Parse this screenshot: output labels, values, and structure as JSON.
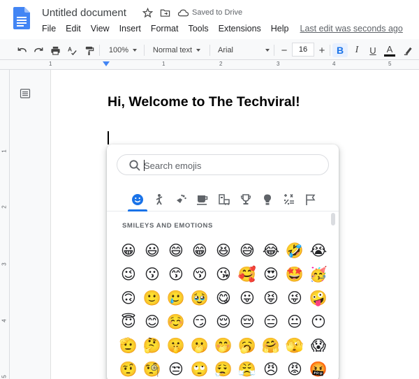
{
  "header": {
    "doc_title": "Untitled document",
    "saved_status": "Saved to Drive",
    "last_edit": "Last edit was seconds ago",
    "menu": [
      "File",
      "Edit",
      "View",
      "Insert",
      "Format",
      "Tools",
      "Extensions",
      "Help"
    ]
  },
  "toolbar": {
    "zoom": "100%",
    "style": "Normal text",
    "font": "Arial",
    "font_size": "16",
    "minus": "−",
    "plus": "+",
    "bold": "B",
    "italic": "I",
    "underline": "U",
    "text_color": "A"
  },
  "ruler": {
    "numbers": [
      "1",
      "1",
      "2",
      "3",
      "4",
      "5"
    ],
    "vnumbers": [
      "1",
      "2",
      "3",
      "4",
      "5"
    ]
  },
  "document": {
    "heading": "Hi, Welcome to The Techviral!"
  },
  "emoji_panel": {
    "search_placeholder": "Search emojis",
    "categories": [
      "smileys-icon",
      "people-icon",
      "animals-nature-icon",
      "food-drink-icon",
      "travel-places-icon",
      "activities-icon",
      "objects-icon",
      "symbols-icon",
      "flags-icon"
    ],
    "active_category": "smileys-icon",
    "section_title": "SMILEYS AND EMOTIONS",
    "emojis": [
      "😀",
      "😃",
      "😄",
      "😁",
      "😆",
      "😅",
      "😂",
      "🤣",
      "😭",
      "😉",
      "😗",
      "😙",
      "😚",
      "😘",
      "🥰",
      "😍",
      "🤩",
      "🥳",
      "🙃",
      "🙂",
      "🥲",
      "🥹",
      "😋",
      "😛",
      "😝",
      "😜",
      "🤪",
      "😇",
      "😊",
      "☺️",
      "😏",
      "😌",
      "😔",
      "😑",
      "😐",
      "😶",
      "🫡",
      "🤔",
      "🤫",
      "🫢",
      "🤭",
      "🥱",
      "🤗",
      "🫣",
      "😱",
      "🤨",
      "🧐",
      "😒",
      "🙄",
      "😮‍💨",
      "😤",
      "😠",
      "😡",
      "🤬"
    ]
  },
  "colors": {
    "accent": "#1a73e8",
    "docs_blue": "#4285f4"
  }
}
